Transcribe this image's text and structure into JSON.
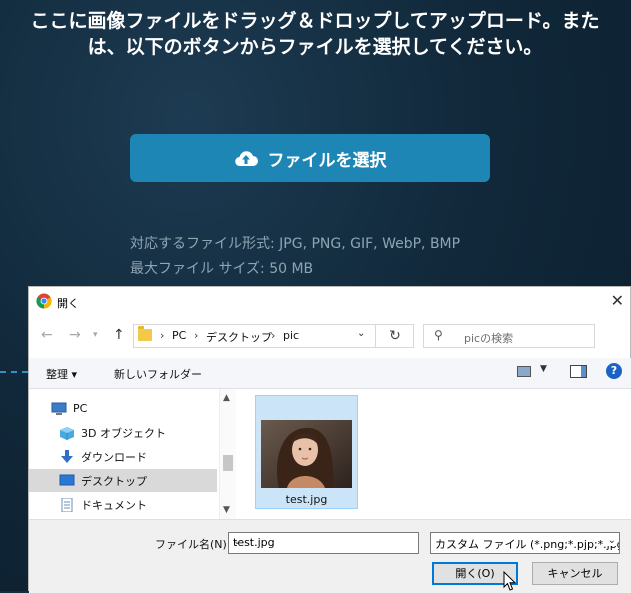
{
  "upload": {
    "title": "ここに画像ファイルをドラッグ＆ドロップしてアップロード。または、以下のボタンからファイルを選択してください。",
    "select_button": "ファイルを選択",
    "formats_line": "対応するファイル形式: JPG, PNG, GIF, WebP, BMP",
    "max_size_line": "最大ファイル サイズ: 50 MB",
    "accent_color": "#1e86b5"
  },
  "dialog": {
    "title": "開く",
    "close_label": "✕",
    "breadcrumb": [
      "PC",
      "デスクトップ",
      "pic"
    ],
    "search_placeholder": "picの検索",
    "toolbar": {
      "organize": "整理 ▾",
      "new_folder": "新しいフォルダー",
      "help": "?"
    },
    "sidebar": [
      {
        "label": "PC",
        "icon": "pc-icon"
      },
      {
        "label": "3D オブジェクト",
        "icon": "3d-objects-icon"
      },
      {
        "label": "ダウンロード",
        "icon": "download-icon"
      },
      {
        "label": "デスクトップ",
        "icon": "desktop-icon",
        "selected": true
      },
      {
        "label": "ドキュメント",
        "icon": "document-icon"
      }
    ],
    "files": [
      {
        "name": "test.jpg",
        "selected": true
      }
    ],
    "file_name_label": "ファイル名(N):",
    "file_name_value": "test.jpg",
    "file_type_filter": "カスタム ファイル (*.png;*.pjp;*.jpg",
    "open_button": "開く(O)",
    "cancel_button": "キャンセル"
  }
}
